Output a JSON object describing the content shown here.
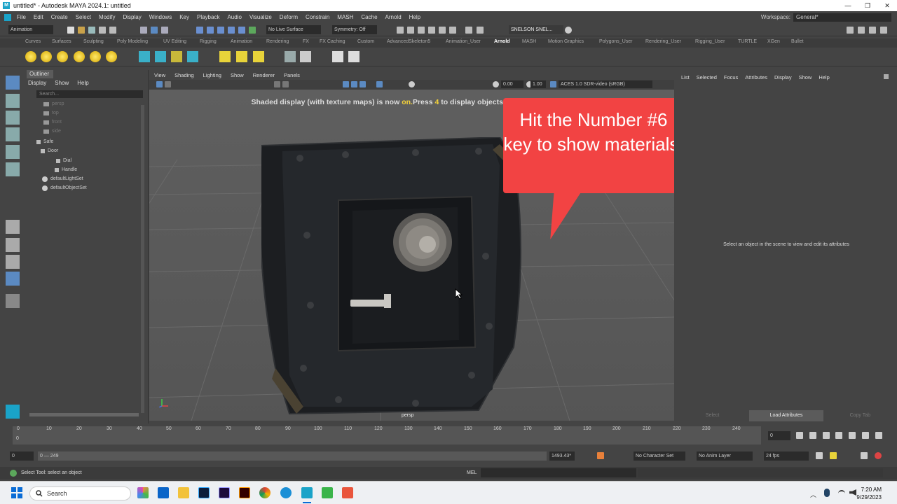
{
  "window": {
    "title": "untitled* - Autodesk MAYA 2024.1: untitled",
    "buttons": [
      "—",
      "❐",
      "✕"
    ]
  },
  "menubar": {
    "items": [
      "File",
      "Edit",
      "Create",
      "Select",
      "Modify",
      "Display",
      "Windows",
      "Key",
      "Playback",
      "Audio",
      "Visualize",
      "Deform",
      "Constrain",
      "MASH",
      "Cache",
      "Arnold",
      "Help"
    ],
    "workspace_label": "Workspace:",
    "workspace_value": "General*"
  },
  "statusline": {
    "mode": "Animation",
    "live_surface": "No Live Surface",
    "symmetry": "Symmetry: Off",
    "user": "SNELSON SNEL..."
  },
  "shelf_tabs": [
    "Curves",
    "Surfaces",
    "Sculpting",
    "Poly Modeling",
    "UV Editing",
    "Rigging",
    "Animation",
    "Rendering",
    "FX",
    "FX Caching",
    "Custom",
    "AdvancedSkeleton5",
    "Animation_User",
    "Arnold",
    "MASH",
    "Motion Graphics",
    "Polygons_User",
    "Rendering_User",
    "Rigging_User",
    "TURTLE",
    "XGen",
    "Bullet"
  ],
  "active_shelf_tab": "Arnold",
  "outliner": {
    "tab": "Outliner",
    "menu": [
      "Display",
      "Show",
      "Help"
    ],
    "search_placeholder": "Search...",
    "nodes": [
      "persp",
      "top",
      "front",
      "side",
      "Safe",
      "Door",
      "Dial",
      "Handle",
      "defaultLightSet",
      "defaultObjectSet"
    ]
  },
  "viewport": {
    "menu": [
      "View",
      "Shading",
      "Lighting",
      "Show",
      "Renderer",
      "Panels"
    ],
    "field1": "0.00",
    "field2": "1.00",
    "colorspace": "ACES 1.0 SDR-video (sRGB)",
    "hud_prefix": "Shaded display (with texture maps) is now ",
    "hud_on": "on.",
    "hud_mid": "Press ",
    "hud_key": "4",
    "hud_suffix": " to display objects in wireframe mode.",
    "camera_label": "persp"
  },
  "callout": {
    "text": "Hit the Number #6 key to show materials."
  },
  "attribute_editor": {
    "menu": [
      "List",
      "Selected",
      "Focus",
      "Attributes",
      "Display",
      "Show",
      "Help"
    ],
    "message": "Select an object in the scene to view and edit its attributes",
    "buttons": [
      "Select",
      "Load Attributes",
      "Copy Tab"
    ]
  },
  "timeline": {
    "ticks": [
      "0",
      "10",
      "20",
      "30",
      "40",
      "50",
      "60",
      "70",
      "80",
      "90",
      "100",
      "110",
      "120",
      "130",
      "140",
      "150",
      "160",
      "170",
      "180",
      "190",
      "200",
      "210",
      "220",
      "230",
      "240"
    ],
    "current_marker": "0",
    "current_frame": "0"
  },
  "range": {
    "start": "0",
    "range_label": "0 — 249",
    "end_value": "1493.43*",
    "character_set": "No Character Set",
    "anim_layer": "No Anim Layer",
    "fps": "24 fps"
  },
  "helpline": {
    "text": "Select Tool: select an object",
    "mel_label": "MEL"
  },
  "taskbar": {
    "search": "Search",
    "time": "7:20 AM",
    "date": "9/29/2023"
  }
}
